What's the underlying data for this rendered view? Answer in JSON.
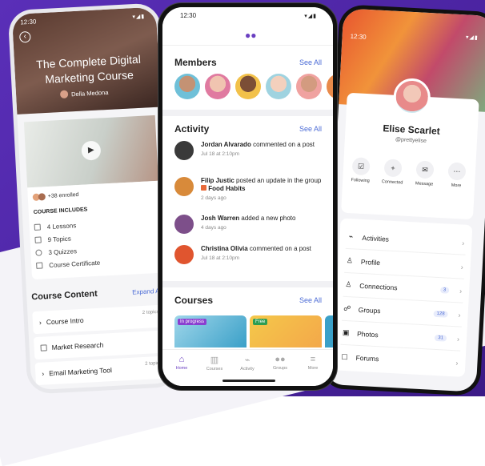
{
  "course_screen": {
    "time": "12:30",
    "title": "The Complete Digital Marketing Course",
    "author": "Della Medona",
    "enrolled": "+38 enrolled",
    "includes_heading": "COURSE INCLUDES",
    "includes": [
      "4 Lessons",
      "9 Topics",
      "3 Quizzes",
      "Course Certificate"
    ],
    "content_heading": "Course Content",
    "expand_all": "Expand All",
    "lessons": [
      {
        "title": "Course Intro",
        "topics": "2 topics"
      },
      {
        "title": "Market Research",
        "topics": ""
      },
      {
        "title": "Email Marketing Tool",
        "topics": "2 topics"
      }
    ]
  },
  "community_screen": {
    "time": "12:30",
    "members_heading": "Members",
    "activity_heading": "Activity",
    "courses_heading": "Courses",
    "see_all": "See All",
    "activities": [
      {
        "name": "Jordan Alvarado",
        "action": "commented on a post",
        "time": "Jul 18 at 2:10pm"
      },
      {
        "name": "Filip Justic",
        "action": "posted an update in the group",
        "group": "Food Habits",
        "time": "2 days ago"
      },
      {
        "name": "Josh Warren",
        "action": "added a new photo",
        "time": "4 days ago"
      },
      {
        "name": "Christina Olivia",
        "action": "commented on a post",
        "time": "Jul 18 at 2:10pm"
      }
    ],
    "course_tags": [
      "In progress",
      "Free"
    ],
    "tabs": [
      "Home",
      "Courses",
      "Activity",
      "Groups",
      "More"
    ]
  },
  "profile_screen": {
    "time": "12:30",
    "name": "Elise Scarlet",
    "username": "@prettyelise",
    "actions": [
      "Following",
      "Connected",
      "Message",
      "More"
    ],
    "menu": [
      {
        "label": "Activities",
        "badge": ""
      },
      {
        "label": "Profile",
        "badge": ""
      },
      {
        "label": "Connections",
        "badge": "3"
      },
      {
        "label": "Groups",
        "badge": "128"
      },
      {
        "label": "Photos",
        "badge": "31"
      },
      {
        "label": "Forums",
        "badge": ""
      }
    ]
  },
  "colors": {
    "accent": "#6a3fc1",
    "link": "#4b6bd6",
    "background": "#4a23a0"
  }
}
